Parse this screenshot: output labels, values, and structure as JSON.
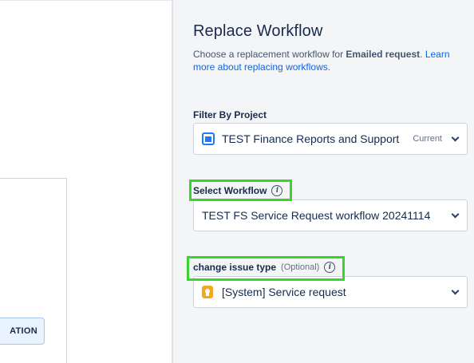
{
  "left_canvas": {
    "status_node_label": "ATION"
  },
  "panel": {
    "title": "Replace Workflow",
    "description": {
      "prefix": "Choose a replacement workflow for ",
      "issue_type": "Emailed request",
      "period": ".",
      "link": "Learn more about replacing workflows."
    },
    "filter_by_project": {
      "label": "Filter By Project",
      "value": "TEST Finance Reports and Support",
      "badge": "Current",
      "icon": "project-icon"
    },
    "select_workflow": {
      "label": "Select Workflow",
      "value": "TEST FS Service Request workflow 20241114",
      "info_icon": "info-icon"
    },
    "change_issue_type": {
      "label": "change issue type",
      "optional": "(Optional)",
      "value": "[System] Service request",
      "icon": "service-request-icon",
      "info_icon": "info-icon"
    }
  },
  "colors": {
    "highlight": "#39d42c",
    "link": "#0c66e4",
    "panel_bg": "#f4f5f7",
    "project_icon": "#1d7afc",
    "issue_type_icon": "#f5a623"
  }
}
